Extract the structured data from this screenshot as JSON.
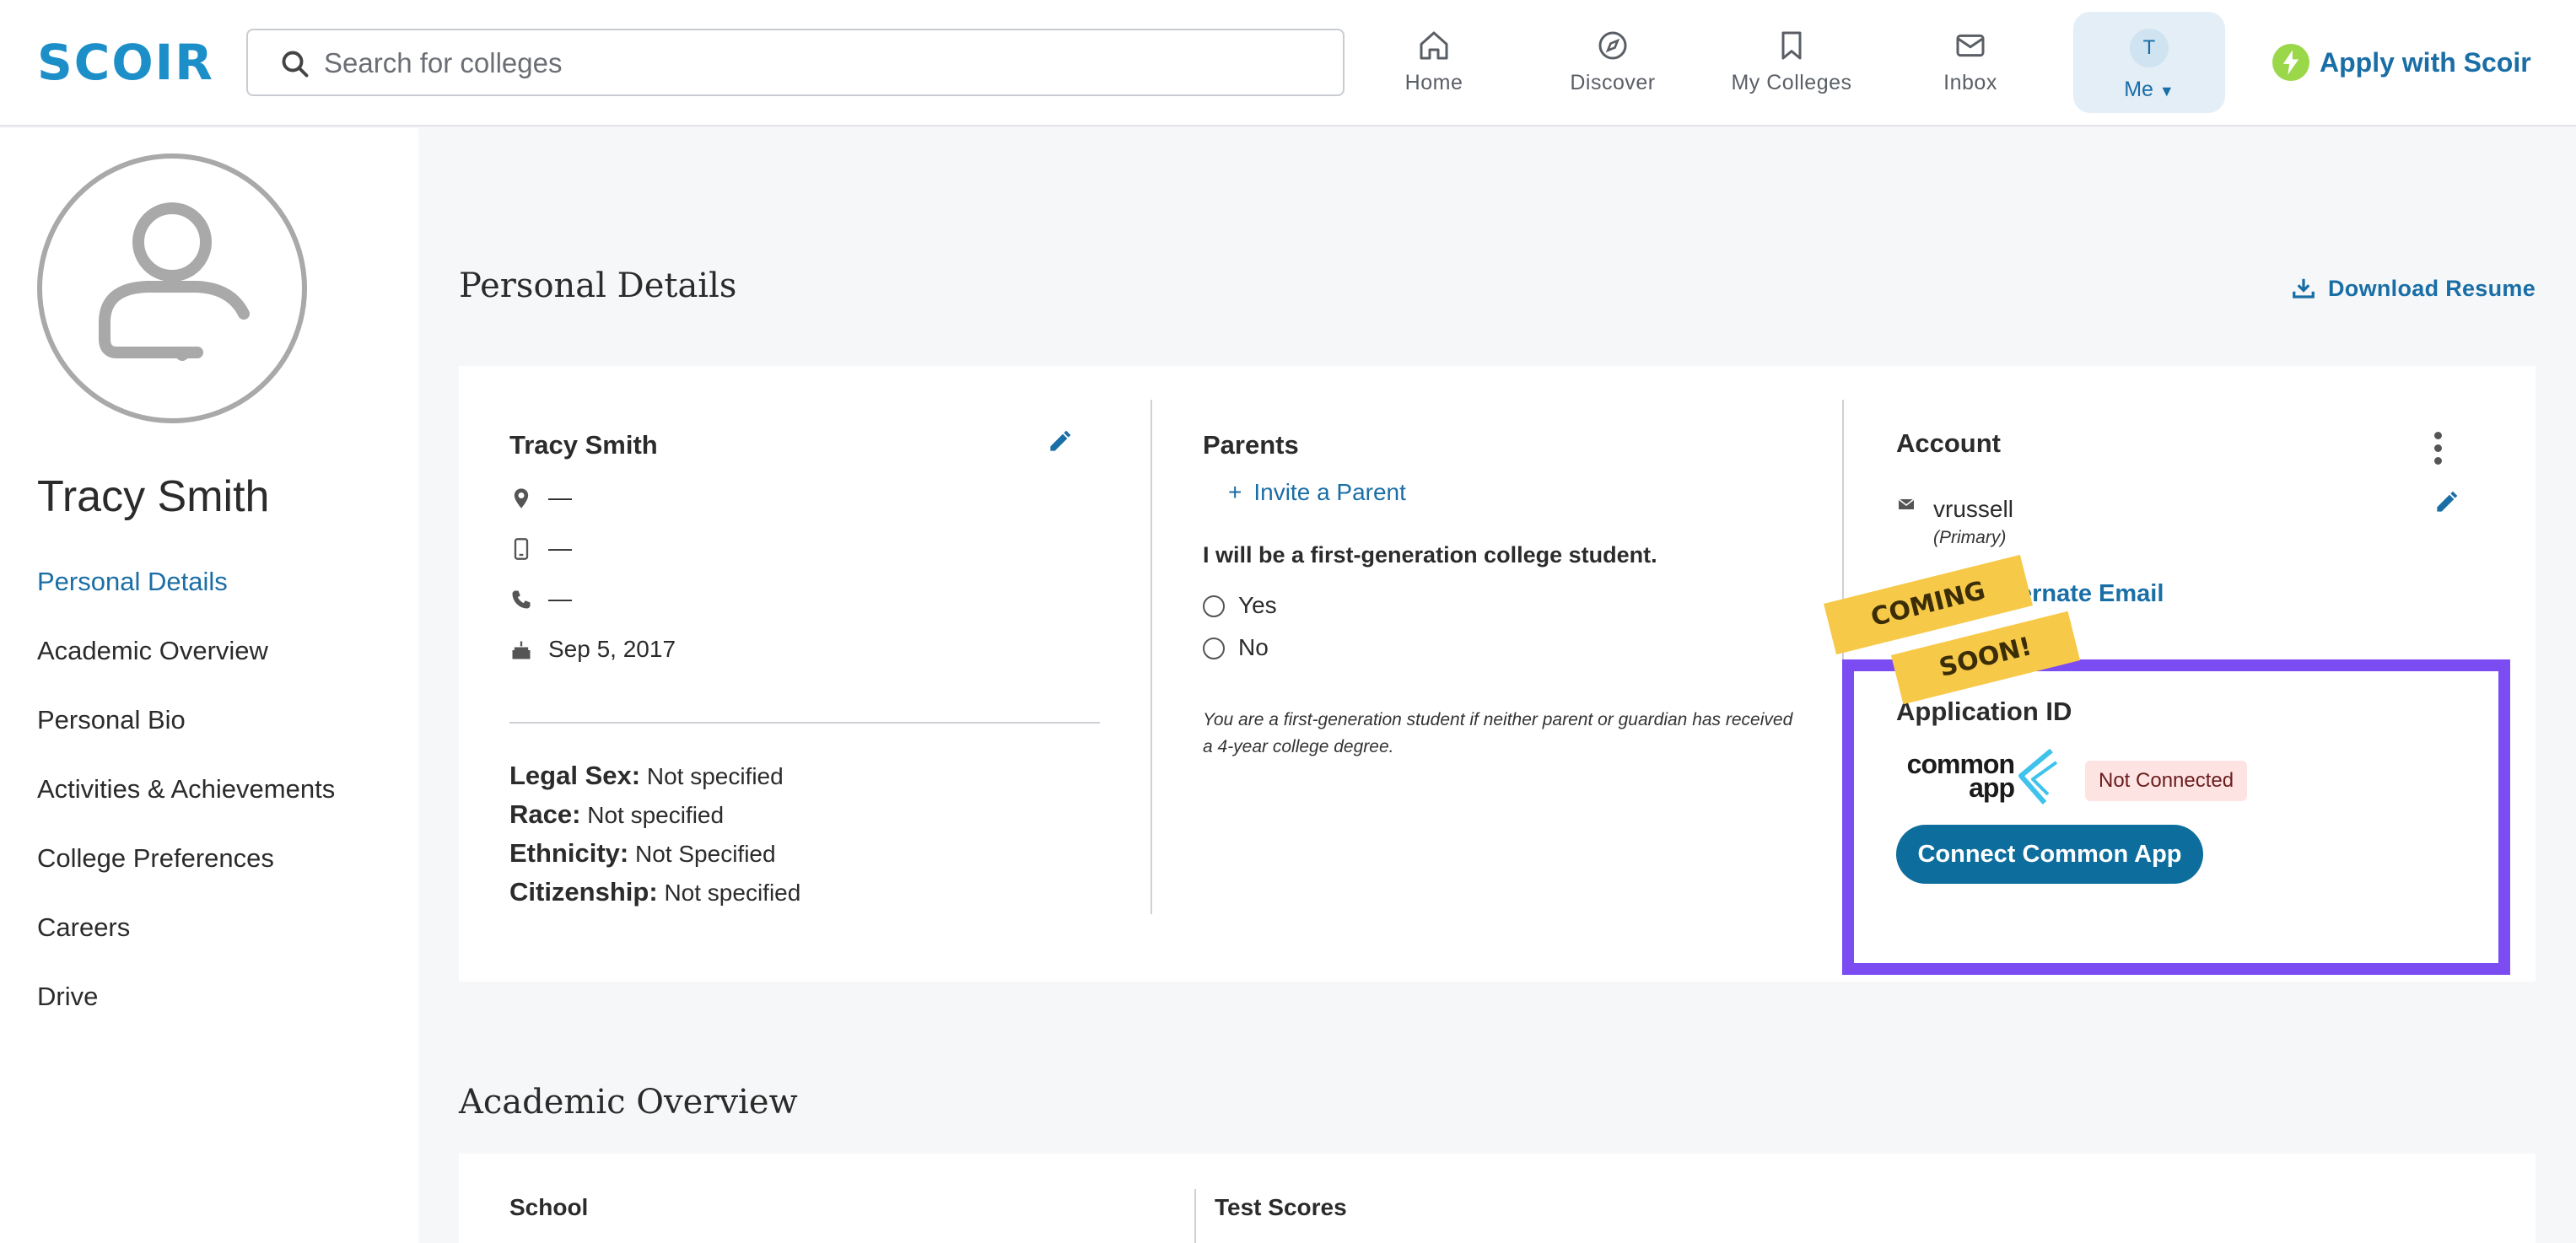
{
  "header": {
    "logo": "SCOIR",
    "search_placeholder": "Search for colleges",
    "nav": [
      {
        "label": "Home",
        "icon": "home-icon"
      },
      {
        "label": "Discover",
        "icon": "compass-icon"
      },
      {
        "label": "My Colleges",
        "icon": "bookmark-icon"
      },
      {
        "label": "Inbox",
        "icon": "mail-icon"
      }
    ],
    "me": {
      "initial": "T",
      "label": "Me"
    },
    "apply_label": "Apply with Scoir",
    "colors": {
      "accent": "#1a6ea6",
      "logo": "#1c8fc9",
      "bolt": "#9ad84a"
    }
  },
  "sidebar": {
    "name": "Tracy Smith",
    "items": [
      {
        "label": "Personal Details",
        "active": true
      },
      {
        "label": "Academic Overview",
        "active": false
      },
      {
        "label": "Personal Bio",
        "active": false
      },
      {
        "label": "Activities & Achievements",
        "active": false
      },
      {
        "label": "College Preferences",
        "active": false
      },
      {
        "label": "Careers",
        "active": false
      },
      {
        "label": "Drive",
        "active": false
      }
    ]
  },
  "main": {
    "personal_title": "Personal Details",
    "download_label": "Download Resume",
    "profile": {
      "name": "Tracy Smith",
      "location": "—",
      "mobile": "—",
      "phone": "—",
      "birthday": "Sep 5, 2017",
      "fields": [
        {
          "key": "Legal Sex:",
          "value": "Not specified"
        },
        {
          "key": "Race:",
          "value": "Not specified"
        },
        {
          "key": "Ethnicity:",
          "value": "Not Specified"
        },
        {
          "key": "Citizenship:",
          "value": "Not specified"
        }
      ]
    },
    "parents": {
      "title": "Parents",
      "invite_label": "Invite a Parent",
      "question": "I will be a first-generation college student.",
      "options": [
        "Yes",
        "No"
      ],
      "note": "You are a first-generation student if neither parent or guardian has received a 4-year college degree."
    },
    "account": {
      "title": "Account",
      "email": "vrussell",
      "email_tag": "(Primary)",
      "add_email_label": "Add Alternate Email"
    },
    "application_id": {
      "title": "Application ID",
      "logo_text_line1": "common",
      "logo_text_line2": "app",
      "status": "Not Connected",
      "connect_label": "Connect Common App",
      "ribbon_line1": "COMING",
      "ribbon_line2": "SOON!",
      "colors": {
        "highlight": "#7b4cf2",
        "ribbon": "#f7c948",
        "button": "#0d6e9e"
      }
    },
    "academic_title": "Academic Overview",
    "academic_cols": {
      "school": "School",
      "test_scores": "Test Scores"
    }
  }
}
